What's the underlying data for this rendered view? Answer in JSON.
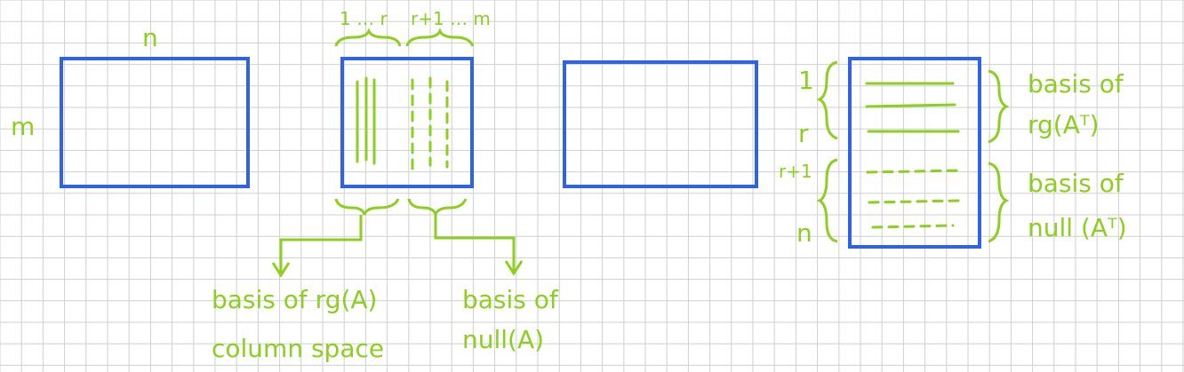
{
  "colors": {
    "grid": "#cfcfcf",
    "matrix_border": "#2e63e6",
    "ink": "#8ccf1f",
    "background": "#ffffff"
  },
  "labels": {
    "n_top": "n",
    "m_left": "m",
    "col_index_1_r": "1 … r",
    "col_index_r1_m": "r+1 … m",
    "basis_rg_a": "basis of rg(A)",
    "column_space": "column space",
    "basis_null_a_line1": "basis of",
    "basis_null_a_line2": "null(A)",
    "row_index_1": "1",
    "row_index_r": "r",
    "row_index_r1": "r+1",
    "row_index_n": "n",
    "basis_rg_at_line1": "basis of",
    "basis_rg_at_line2": "rg(Aᵀ)",
    "basis_null_at_line1": "basis of",
    "basis_null_at_line2": "null (Aᵀ)"
  }
}
